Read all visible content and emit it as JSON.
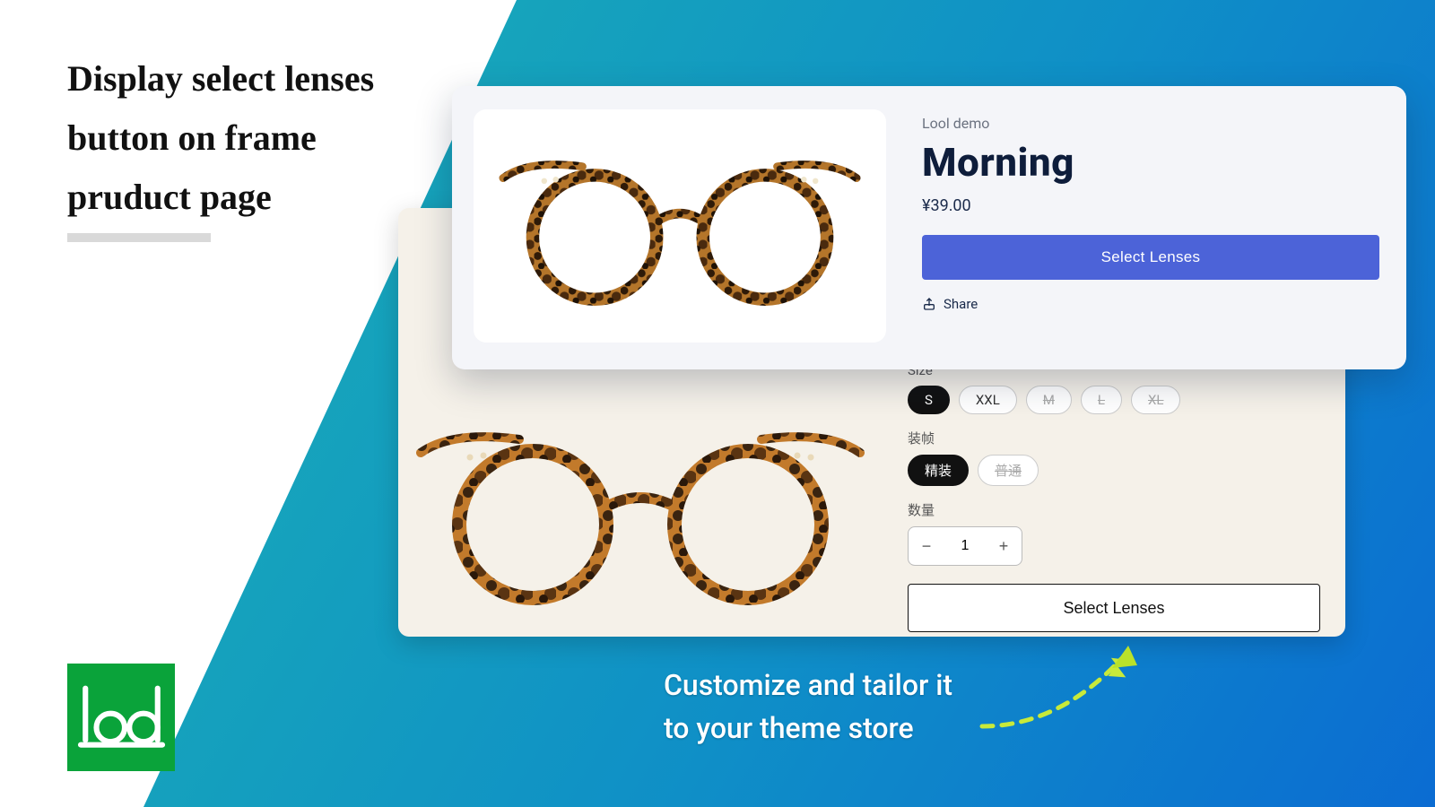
{
  "headline": "Display select lenses button on frame pruduct page",
  "footer": {
    "line1": "Customize and tailor it",
    "line2": "to your theme store"
  },
  "card1": {
    "vendor": "Lool demo",
    "title": "Morning",
    "price": "¥39.00",
    "select_button": "Select Lenses",
    "share_label": "Share"
  },
  "card2": {
    "size_label": "Size",
    "sizes": [
      {
        "value": "S",
        "state": "active"
      },
      {
        "value": "XXL",
        "state": "normal"
      },
      {
        "value": "M",
        "state": "disabled"
      },
      {
        "value": "L",
        "state": "disabled"
      },
      {
        "value": "XL",
        "state": "disabled"
      }
    ],
    "binding_label": "装帧",
    "bindings": [
      {
        "value": "精装",
        "state": "active"
      },
      {
        "value": "普通",
        "state": "disabled"
      }
    ],
    "qty_label": "数量",
    "qty_value": "1",
    "select_button": "Select Lenses"
  },
  "logo_text": "lool"
}
